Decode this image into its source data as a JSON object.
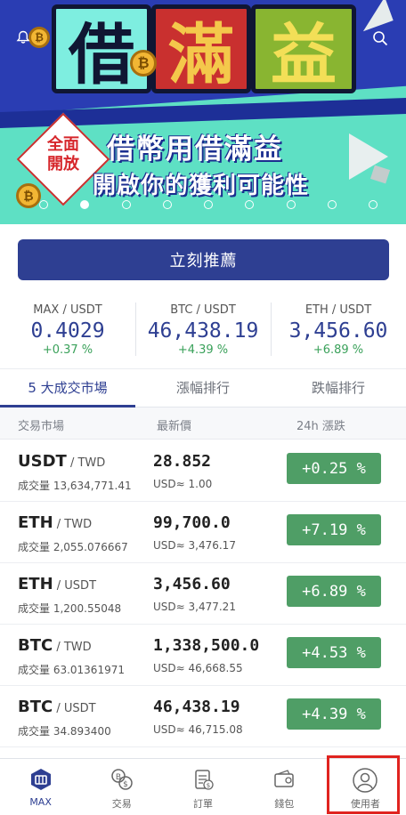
{
  "banner": {
    "title_chars": [
      "借",
      "滿",
      "益"
    ],
    "badge_line1": "全面",
    "badge_line2": "開放",
    "headline": "借幣用借滿益",
    "subheadline": "開啟你的獲利可能性",
    "dot_count": 9,
    "active_dot": 1
  },
  "cta": {
    "label": "立刻推薦"
  },
  "tickers": [
    {
      "pair": "MAX / USDT",
      "price": "0.4029",
      "change": "+0.37 %"
    },
    {
      "pair": "BTC / USDT",
      "price": "46,438.19",
      "change": "+4.39 %"
    },
    {
      "pair": "ETH / USDT",
      "price": "3,456.60",
      "change": "+6.89 %"
    }
  ],
  "tabs": [
    {
      "label": "5 大成交市場",
      "active": true
    },
    {
      "label": "漲幅排行",
      "active": false
    },
    {
      "label": "跌幅排行",
      "active": false
    }
  ],
  "columns": {
    "market": "交易市場",
    "price": "最新價",
    "change": "24h 漲跌"
  },
  "rows": [
    {
      "base": "USDT",
      "quote": " / TWD",
      "volume": "成交量 13,634,771.41",
      "price": "28.852",
      "usd": "USD≈ 1.00",
      "change": "+0.25 %"
    },
    {
      "base": "ETH",
      "quote": " / TWD",
      "volume": "成交量 2,055.076667",
      "price": "99,700.0",
      "usd": "USD≈ 3,476.17",
      "change": "+7.19 %"
    },
    {
      "base": "ETH",
      "quote": " / USDT",
      "volume": "成交量 1,200.55048",
      "price": "3,456.60",
      "usd": "USD≈ 3,477.21",
      "change": "+6.89 %"
    },
    {
      "base": "BTC",
      "quote": " / TWD",
      "volume": "成交量 63.01361971",
      "price": "1,338,500.0",
      "usd": "USD≈ 46,668.55",
      "change": "+4.53 %"
    },
    {
      "base": "BTC",
      "quote": " / USDT",
      "volume": "成交量 34.893400",
      "price": "46,438.19",
      "usd": "USD≈ 46,715.08",
      "change": "+4.39 %"
    }
  ],
  "nav": [
    {
      "label": "MAX",
      "icon": "max-logo-icon",
      "active": true
    },
    {
      "label": "交易",
      "icon": "exchange-icon",
      "active": false
    },
    {
      "label": "訂單",
      "icon": "orders-icon",
      "active": false
    },
    {
      "label": "錢包",
      "icon": "wallet-icon",
      "active": false
    },
    {
      "label": "使用者",
      "icon": "user-icon",
      "active": false
    }
  ],
  "colors": {
    "accent": "#2e3f92",
    "positive": "#4f9e66",
    "positive_text": "#3aa15a",
    "banner_bg": "#5ee0c4",
    "highlight": "#e0231f"
  }
}
